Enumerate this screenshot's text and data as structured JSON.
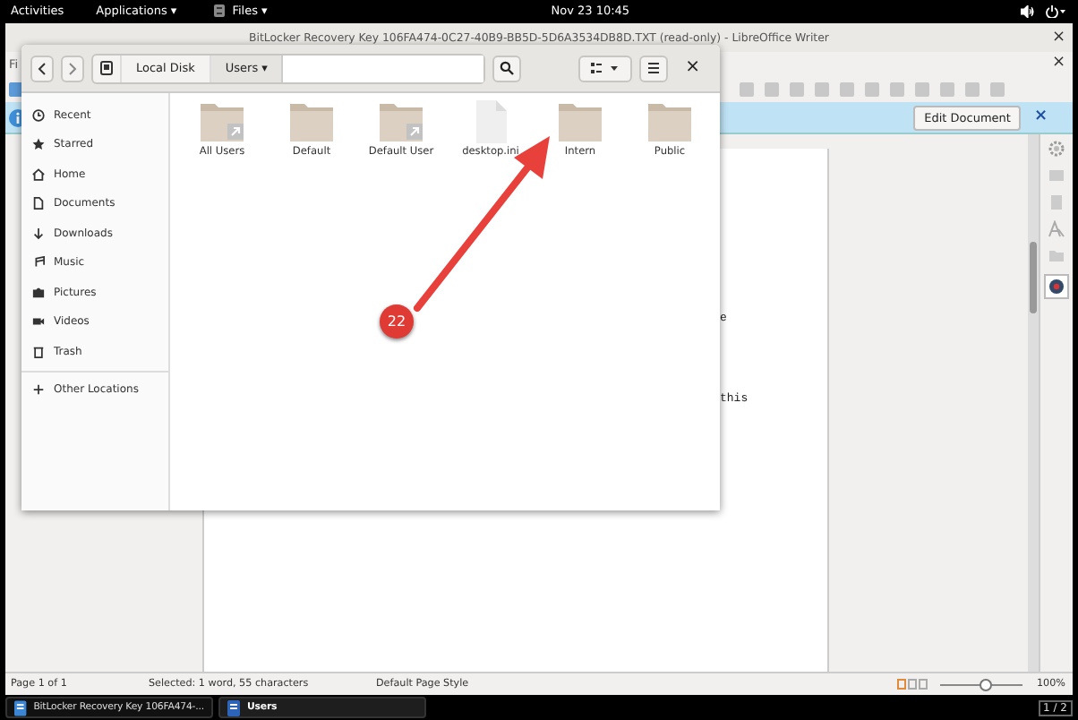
{
  "top_bar": {
    "activities": "Activities",
    "applications": "Applications ▾",
    "files": "Files ▾",
    "clock": "Nov 23  10:45"
  },
  "writer": {
    "title": "BitLocker Recovery Key 106FA474-0C27-40B9-BB5D-5D6A3534DB8D.TXT (read-only) - LibreOffice Writer",
    "close": "×",
    "menu_fragment": "Fi",
    "menu_close": "×",
    "infobar": {
      "button": "Edit Document",
      "close": "×"
    },
    "doc_text": [
      {
        "text": "e"
      },
      {
        "text": "this"
      }
    ],
    "status_bar": {
      "page": "Page 1 of 1",
      "selection": "Selected: 1 word, 55 characters",
      "page_style": "Default Page Style",
      "zoom": {
        "level": 0.55
      },
      "zoom_reading": "100%"
    }
  },
  "files_window": {
    "path": [
      {
        "label": "Local Disk",
        "selected": false
      },
      {
        "label": "Users ▾",
        "selected": true
      }
    ],
    "close": "×",
    "sidebar": [
      {
        "label": "Recent",
        "kind": "recent"
      },
      {
        "label": "Starred",
        "kind": "star"
      },
      {
        "label": "Home",
        "kind": "home"
      },
      {
        "label": "Documents",
        "kind": "doc"
      },
      {
        "label": "Downloads",
        "kind": "download"
      },
      {
        "label": "Music",
        "kind": "music"
      },
      {
        "label": "Pictures",
        "kind": "camera"
      },
      {
        "label": "Videos",
        "kind": "video"
      },
      {
        "label": "Trash",
        "kind": "trash"
      },
      {
        "label": "Other Locations",
        "kind": "plus"
      }
    ],
    "items": [
      {
        "name": "All Users",
        "kind": "folder",
        "link": true
      },
      {
        "name": "Default",
        "kind": "folder",
        "link": false
      },
      {
        "name": "Default User",
        "kind": "folder",
        "link": true
      },
      {
        "name": "desktop.ini",
        "kind": "file",
        "link": false
      },
      {
        "name": "Intern",
        "kind": "folder",
        "link": false
      },
      {
        "name": "Public",
        "kind": "folder",
        "link": false
      }
    ]
  },
  "annotation": {
    "badge": "22"
  },
  "taskbar": {
    "tasks": [
      {
        "label": "BitLocker Recovery Key 106FA474-...",
        "selected": false
      },
      {
        "label": "Users",
        "selected": true
      }
    ],
    "workspace": "1 / 2"
  }
}
